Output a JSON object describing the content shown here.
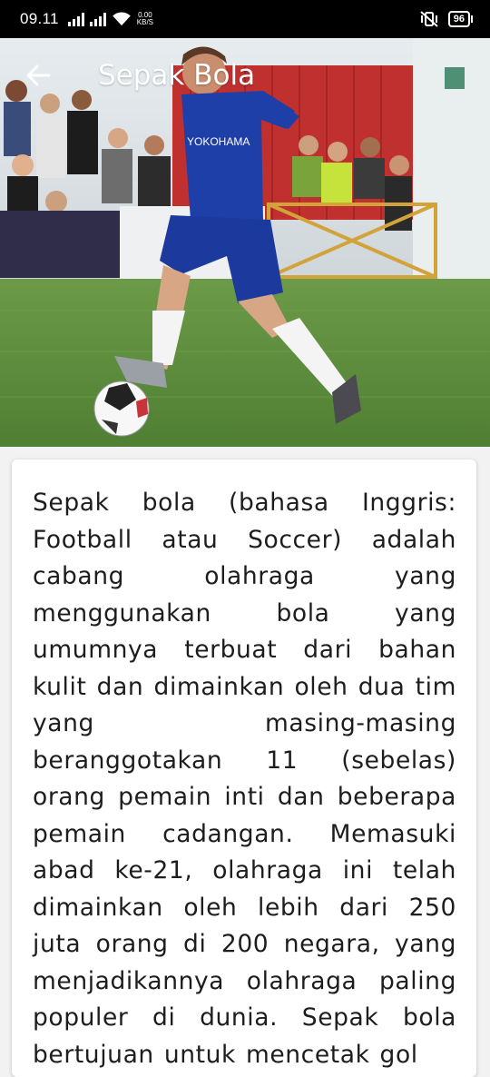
{
  "status_bar": {
    "time": "09.11",
    "network_speed_value": "0.00",
    "network_speed_unit": "KB/S",
    "battery": "96",
    "icons": [
      "signal-icon",
      "signal-icon",
      "wifi-icon",
      "mute-vibrate-icon",
      "battery-icon"
    ]
  },
  "app_bar": {
    "title": "Sepak Bola",
    "back_icon": "arrow-left-icon"
  },
  "hero_image": {
    "description_icon": "football-player-photo",
    "shirt_sponsor": "YOKOHAMA",
    "colors": {
      "kit": "#1f3fa8",
      "grass": "#5a8f3c",
      "banner": "#c0302e"
    }
  },
  "article": {
    "text": "Sepak bola (bahasa Inggris: Football atau Soccer) adalah cabang olahraga yang menggunakan bola yang umumnya terbuat dari bahan kulit dan dimainkan oleh dua tim yang masing-masing beranggotakan 11 (sebelas) orang pemain inti dan beberapa pemain cadangan. Memasuki abad ke-21, olahraga ini telah dimainkan oleh lebih dari 250 juta orang di 200 negara, yang menjadikannya olahraga paling populer di dunia. Sepak bola bertujuan untuk mencetak gol"
  }
}
